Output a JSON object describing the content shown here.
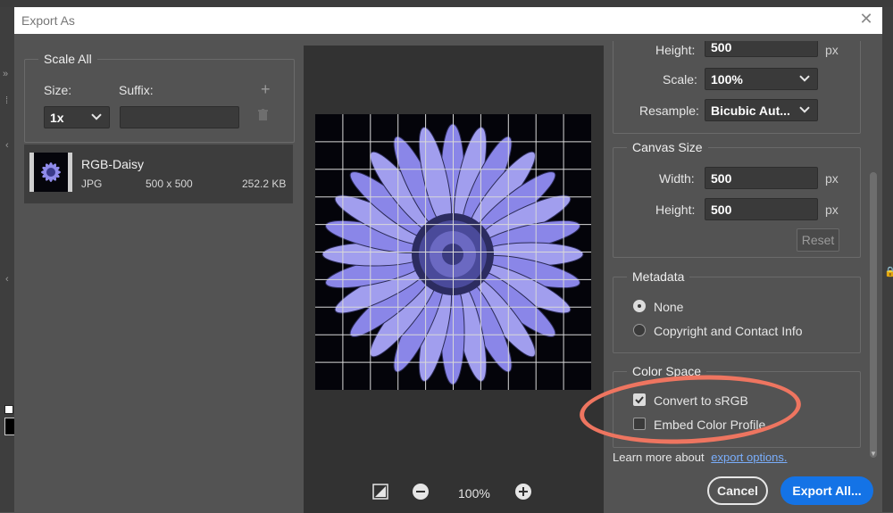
{
  "dialog": {
    "title": "Export As",
    "close_icon": "close-icon"
  },
  "left": {
    "scale_all_legend": "Scale All",
    "size_label": "Size:",
    "suffix_label": "Suffix:",
    "size_value": "1x",
    "suffix_value": "",
    "asset": {
      "name": "RGB-Daisy",
      "format": "JPG",
      "dimensions": "500 x 500",
      "filesize": "252.2 KB"
    }
  },
  "preview": {
    "zoom": "100%"
  },
  "image_size": {
    "height_label": "Height:",
    "height_value": "500",
    "height_unit": "px",
    "scale_label": "Scale:",
    "scale_value": "100%",
    "resample_label": "Resample:",
    "resample_value": "Bicubic Aut..."
  },
  "canvas_size": {
    "legend": "Canvas Size",
    "width_label": "Width:",
    "width_value": "500",
    "width_unit": "px",
    "height_label": "Height:",
    "height_value": "500",
    "height_unit": "px",
    "reset_label": "Reset"
  },
  "metadata": {
    "legend": "Metadata",
    "options": [
      "None",
      "Copyright and Contact Info"
    ],
    "selected": "None"
  },
  "color_space": {
    "legend": "Color Space",
    "convert_label": "Convert to sRGB",
    "convert_checked": true,
    "embed_label": "Embed Color Profile",
    "embed_checked": false
  },
  "footer": {
    "learn_text": "Learn more about",
    "link_text": "export options.",
    "cancel_label": "Cancel",
    "export_label": "Export All..."
  },
  "colors": {
    "accent": "#1473e6",
    "highlight": "#ee7560",
    "flower": "#8a86e8"
  }
}
